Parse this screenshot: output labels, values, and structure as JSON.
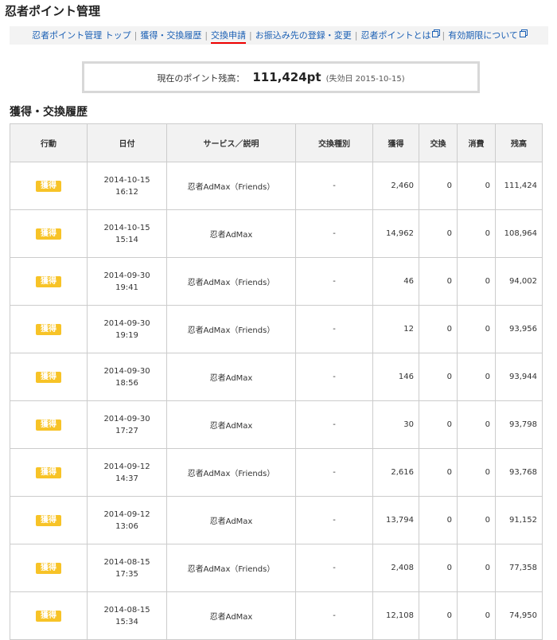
{
  "page_title": "忍者ポイント管理",
  "nav": [
    {
      "label": "忍者ポイント管理 トップ",
      "active": false,
      "external": false
    },
    {
      "label": "獲得・交換履歴",
      "active": false,
      "external": false
    },
    {
      "label": "交換申請",
      "active": true,
      "external": false
    },
    {
      "label": "お振込み先の登録・変更",
      "active": false,
      "external": false
    },
    {
      "label": "忍者ポイントとは",
      "active": false,
      "external": true
    },
    {
      "label": "有効期限について",
      "active": false,
      "external": true
    }
  ],
  "nav_separator": "|",
  "balance": {
    "label": "現在のポイント残高：",
    "value": "111,424pt",
    "expiry": "(失効日 2015-10-15)"
  },
  "section_title": "獲得・交換履歴",
  "table": {
    "headers": [
      "行動",
      "日付",
      "サービス／説明",
      "交換種別",
      "獲得",
      "交換",
      "消費",
      "残高"
    ],
    "rows": [
      {
        "action": "獲得",
        "date": "2014-10-15",
        "time": "16:12",
        "service": "忍者AdMax（Friends）",
        "type": "-",
        "earned": "2,460",
        "exchanged": "0",
        "consumed": "0",
        "balance": "111,424"
      },
      {
        "action": "獲得",
        "date": "2014-10-15",
        "time": "15:14",
        "service": "忍者AdMax",
        "type": "-",
        "earned": "14,962",
        "exchanged": "0",
        "consumed": "0",
        "balance": "108,964"
      },
      {
        "action": "獲得",
        "date": "2014-09-30",
        "time": "19:41",
        "service": "忍者AdMax（Friends）",
        "type": "-",
        "earned": "46",
        "exchanged": "0",
        "consumed": "0",
        "balance": "94,002"
      },
      {
        "action": "獲得",
        "date": "2014-09-30",
        "time": "19:19",
        "service": "忍者AdMax（Friends）",
        "type": "-",
        "earned": "12",
        "exchanged": "0",
        "consumed": "0",
        "balance": "93,956"
      },
      {
        "action": "獲得",
        "date": "2014-09-30",
        "time": "18:56",
        "service": "忍者AdMax",
        "type": "-",
        "earned": "146",
        "exchanged": "0",
        "consumed": "0",
        "balance": "93,944"
      },
      {
        "action": "獲得",
        "date": "2014-09-30",
        "time": "17:27",
        "service": "忍者AdMax",
        "type": "-",
        "earned": "30",
        "exchanged": "0",
        "consumed": "0",
        "balance": "93,798"
      },
      {
        "action": "獲得",
        "date": "2014-09-12",
        "time": "14:37",
        "service": "忍者AdMax（Friends）",
        "type": "-",
        "earned": "2,616",
        "exchanged": "0",
        "consumed": "0",
        "balance": "93,768"
      },
      {
        "action": "獲得",
        "date": "2014-09-12",
        "time": "13:06",
        "service": "忍者AdMax",
        "type": "-",
        "earned": "13,794",
        "exchanged": "0",
        "consumed": "0",
        "balance": "91,152"
      },
      {
        "action": "獲得",
        "date": "2014-08-15",
        "time": "17:35",
        "service": "忍者AdMax（Friends）",
        "type": "-",
        "earned": "2,408",
        "exchanged": "0",
        "consumed": "0",
        "balance": "77,358"
      },
      {
        "action": "獲得",
        "date": "2014-08-15",
        "time": "15:34",
        "service": "忍者AdMax",
        "type": "-",
        "earned": "12,108",
        "exchanged": "0",
        "consumed": "0",
        "balance": "74,950"
      }
    ]
  },
  "colors": {
    "badge": "#f7c327",
    "link": "#1a5fb4",
    "active_underline": "#e00000",
    "header_bg": "#f2f2f2"
  }
}
